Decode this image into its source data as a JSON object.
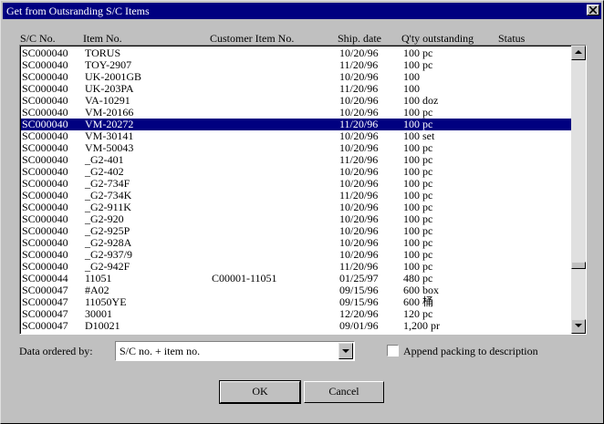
{
  "window": {
    "title": "Get from Outsranding S/C Items"
  },
  "columns": [
    "S/C No.",
    "Item No.",
    "Customer Item No.",
    "Ship. date",
    "Q'ty outstanding",
    "Status"
  ],
  "rows": [
    {
      "sc": "SC000040",
      "item": "TORUS",
      "cust": "",
      "date": "10/20/96",
      "qty": "100 pc"
    },
    {
      "sc": "SC000040",
      "item": "TOY-2907",
      "cust": "",
      "date": "11/20/96",
      "qty": "100 pc"
    },
    {
      "sc": "SC000040",
      "item": "UK-2001GB",
      "cust": "",
      "date": "10/20/96",
      "qty": "100"
    },
    {
      "sc": "SC000040",
      "item": "UK-203PA",
      "cust": "",
      "date": "11/20/96",
      "qty": "100"
    },
    {
      "sc": "SC000040",
      "item": "VA-10291",
      "cust": "",
      "date": "10/20/96",
      "qty": "100 doz"
    },
    {
      "sc": "SC000040",
      "item": "VM-20166",
      "cust": "",
      "date": "10/20/96",
      "qty": "100 pc"
    },
    {
      "sc": "SC000040",
      "item": "VM-20272",
      "cust": "",
      "date": "11/20/96",
      "qty": "100 pc",
      "selected": true
    },
    {
      "sc": "SC000040",
      "item": "VM-30141",
      "cust": "",
      "date": "10/20/96",
      "qty": "100 set"
    },
    {
      "sc": "SC000040",
      "item": "VM-50043",
      "cust": "",
      "date": "10/20/96",
      "qty": "100 pc"
    },
    {
      "sc": "SC000040",
      "item": "_G2-401",
      "cust": "",
      "date": "11/20/96",
      "qty": "100 pc"
    },
    {
      "sc": "SC000040",
      "item": "_G2-402",
      "cust": "",
      "date": "10/20/96",
      "qty": "100 pc"
    },
    {
      "sc": "SC000040",
      "item": "_G2-734F",
      "cust": "",
      "date": "10/20/96",
      "qty": "100 pc"
    },
    {
      "sc": "SC000040",
      "item": "_G2-734K",
      "cust": "",
      "date": "11/20/96",
      "qty": "100 pc"
    },
    {
      "sc": "SC000040",
      "item": "_G2-911K",
      "cust": "",
      "date": "10/20/96",
      "qty": "100 pc"
    },
    {
      "sc": "SC000040",
      "item": "_G2-920",
      "cust": "",
      "date": "10/20/96",
      "qty": "100 pc"
    },
    {
      "sc": "SC000040",
      "item": "_G2-925P",
      "cust": "",
      "date": "10/20/96",
      "qty": "100 pc"
    },
    {
      "sc": "SC000040",
      "item": "_G2-928A",
      "cust": "",
      "date": "10/20/96",
      "qty": "100 pc"
    },
    {
      "sc": "SC000040",
      "item": "_G2-937/9",
      "cust": "",
      "date": "10/20/96",
      "qty": "100 pc"
    },
    {
      "sc": "SC000040",
      "item": "_G2-942F",
      "cust": "",
      "date": "11/20/96",
      "qty": "100 pc"
    },
    {
      "sc": "SC000044",
      "item": "11051",
      "cust": "C00001-11051",
      "date": "01/25/97",
      "qty": "480 pc"
    },
    {
      "sc": "SC000047",
      "item": "#A02",
      "cust": "",
      "date": "09/15/96",
      "qty": "600 box"
    },
    {
      "sc": "SC000047",
      "item": "11050YE",
      "cust": "",
      "date": "09/15/96",
      "qty": "600 桶"
    },
    {
      "sc": "SC000047",
      "item": "30001",
      "cust": "",
      "date": "12/20/96",
      "qty": "120 pc"
    },
    {
      "sc": "SC000047",
      "item": "D10021",
      "cust": "",
      "date": "09/01/96",
      "qty": "1,200 pr"
    }
  ],
  "scrollbar": {
    "position": 0.8
  },
  "order": {
    "label": "Data ordered by:",
    "value": "S/C no. + item no."
  },
  "append": {
    "label": "Append packing to description",
    "checked": false
  },
  "buttons": {
    "ok": "OK",
    "cancel": "Cancel"
  }
}
